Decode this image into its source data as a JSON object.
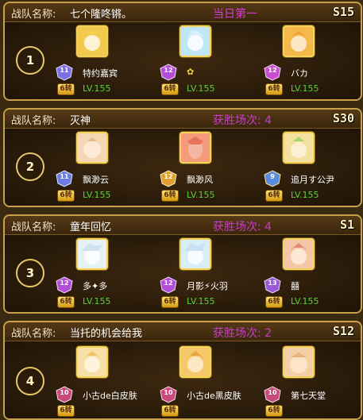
{
  "header_label": "战队名称:",
  "colors": {
    "first_place": "#d63ad6",
    "wins": "#c63ec6",
    "level": "#5bd23a",
    "gold_border": "#c8a14a"
  },
  "teams": [
    {
      "rank": "1",
      "name": "七个隆咚锵。",
      "status": "当日第一",
      "server": "S15",
      "members": [
        {
          "name": "特约嘉宾",
          "emblem": "11",
          "zhuan": "6转",
          "level": "LV.155",
          "avatar_hue": "#f2c94c"
        },
        {
          "name": "✿",
          "emblem": "12",
          "zhuan": "6转",
          "level": "LV.155",
          "avatar_hue": "#bfe6f5"
        },
        {
          "name": "バカ",
          "emblem": "12",
          "zhuan": "6转",
          "level": "LV.155",
          "avatar_hue": "#f5b84a"
        }
      ]
    },
    {
      "rank": "2",
      "name": "灭⁣神",
      "status": "获胜场次: 4",
      "server": "S30",
      "members": [
        {
          "name": "⁣飘渺云⁣",
          "emblem": "11",
          "zhuan": "6转",
          "level": "LV.155",
          "avatar_hue": "#f6d7b5"
        },
        {
          "name": "⁣飘渺风⁣",
          "emblem": "12",
          "zhuan": "6转",
          "level": "LV.155",
          "avatar_hue": "#f59a7a"
        },
        {
          "name": "追月す公尹",
          "emblem": "9",
          "zhuan": "6转",
          "level": "LV.155",
          "avatar_hue": "#f4e0a0"
        }
      ]
    },
    {
      "rank": "3",
      "name": "童年回忆",
      "status": "获胜场次: 4",
      "server": "S1",
      "members": [
        {
          "name": "⁣多✦多⁣",
          "emblem": "12",
          "zhuan": "6转",
          "level": "LV.155",
          "avatar_hue": "#e6f2f7"
        },
        {
          "name": "月影⚡火羽",
          "emblem": "12",
          "zhuan": "6转",
          "level": "LV.155",
          "avatar_hue": "#d8eef8"
        },
        {
          "name": "囍",
          "emblem": "13",
          "zhuan": "6转",
          "level": "LV.155",
          "avatar_hue": "#f4c7a9"
        }
      ]
    },
    {
      "rank": "4",
      "name": "当托的机会给我",
      "status": "获胜场次: 2",
      "server": "S12",
      "members": [
        {
          "name": "小古de白皮肤",
          "emblem": "10",
          "zhuan": "6转",
          "level": "",
          "avatar_hue": "#f6e0a8"
        },
        {
          "name": "小古de黑皮肤",
          "emblem": "10",
          "zhuan": "6转",
          "level": "",
          "avatar_hue": "#f5c96a"
        },
        {
          "name": "第七天堂",
          "emblem": "10",
          "zhuan": "6转",
          "level": "",
          "avatar_hue": "#f3cfa8"
        }
      ]
    }
  ]
}
